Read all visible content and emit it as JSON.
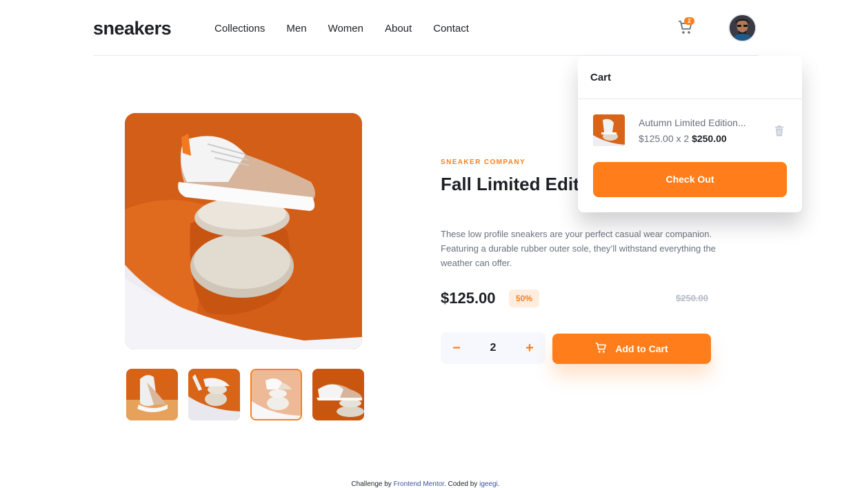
{
  "header": {
    "logo": "sneakers",
    "nav": [
      "Collections",
      "Men",
      "Women",
      "About",
      "Contact"
    ],
    "cart_count": "2",
    "avatar": "user-avatar"
  },
  "product": {
    "company": "SNEAKER COMPANY",
    "title": "Fall Limited Edition Sneakers",
    "description": "These low profile sneakers are your perfect casual wear companion. Featuring a durable rubber outer sole, they’ll withstand everything the weather can offer.",
    "price": "$125.00",
    "discount": "50%",
    "old_price": "$250.00",
    "quantity": "2",
    "minus": "−",
    "plus": "+",
    "add_to_cart": "Add to Cart",
    "selected_thumbnail": 3
  },
  "cart": {
    "heading": "Cart",
    "item_name": "Autumn Limited Edition...",
    "item_unit": "$125.00 x 2",
    "item_total": "$250.00",
    "checkout": "Check Out"
  },
  "footer": {
    "prefix": "Challenge by",
    "link1": "Frontend Mentor",
    "middle": ". Coded by",
    "link2": "igeegi",
    "suffix": "."
  },
  "colors": {
    "accent": "#ff7e1b",
    "accent_pale": "#ffede0",
    "dark": "#1d2026",
    "gray": "#68707d",
    "light_gray": "#b6bcc8"
  }
}
